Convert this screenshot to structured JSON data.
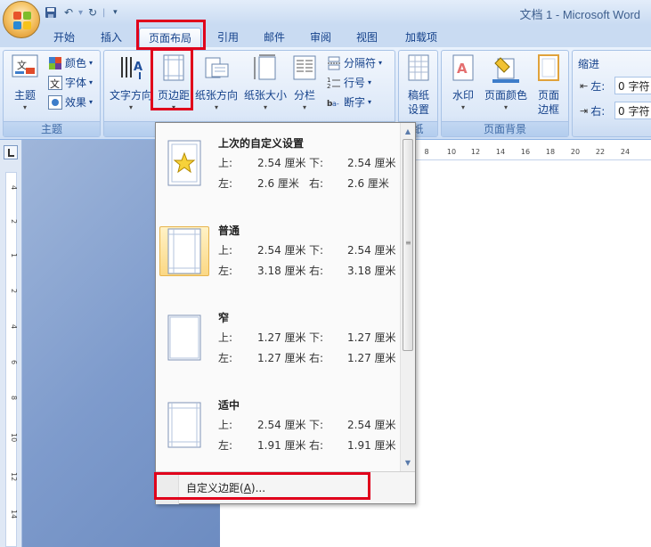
{
  "window": {
    "title": "文档 1 - Microsoft Word"
  },
  "qat": {
    "items": [
      "save-icon",
      "undo-icon",
      "redo-icon",
      "customize-icon"
    ]
  },
  "tabs": [
    {
      "label": "开始"
    },
    {
      "label": "插入"
    },
    {
      "label": "页面布局",
      "active": true
    },
    {
      "label": "引用"
    },
    {
      "label": "邮件"
    },
    {
      "label": "审阅"
    },
    {
      "label": "视图"
    },
    {
      "label": "加载项"
    }
  ],
  "ribbon": {
    "themes": {
      "group_label": "主题",
      "themes_label": "主题",
      "colors_label": "颜色",
      "fonts_label": "字体",
      "effects_label": "效果"
    },
    "page_setup": {
      "text_direction": "文字方向",
      "margins": "页边距",
      "orientation": "纸张方向",
      "size": "纸张大小",
      "columns": "分栏",
      "breaks": "分隔符",
      "line_numbers": "行号",
      "hyphenation": "断字"
    },
    "draft_paper": {
      "label_line1": "稿纸",
      "label_line2": "设置",
      "group_label": "纸"
    },
    "page_background": {
      "group_label": "页面背景",
      "watermark": "水印",
      "page_color": "页面颜色",
      "page_borders_line1": "页面",
      "page_borders_line2": "边框"
    },
    "paragraph": {
      "indent_title": "缩进",
      "left_label": "左:",
      "left_value": "0 字符",
      "right_label": "右:",
      "right_value": "0 字符"
    }
  },
  "rulers": {
    "horizontal_ticks": [
      "8",
      "10",
      "12",
      "14",
      "16",
      "18",
      "20",
      "22",
      "24"
    ],
    "vertical_ticks": [
      "4",
      "2",
      "1",
      "2",
      "4",
      "6",
      "8",
      "10",
      "12",
      "14"
    ]
  },
  "margins_menu": {
    "options": [
      {
        "name": "上次的自定义设置",
        "top_label": "上:",
        "top": "2.54 厘米",
        "bottom_label": "下:",
        "bottom": "2.54 厘米",
        "left_label": "左:",
        "left": "2.6 厘米",
        "right_label": "右:",
        "right": "2.6 厘米",
        "thumb": "star"
      },
      {
        "name": "普通",
        "top_label": "上:",
        "top": "2.54 厘米",
        "bottom_label": "下:",
        "bottom": "2.54 厘米",
        "left_label": "左:",
        "left": "3.18 厘米",
        "right_label": "右:",
        "right": "3.18 厘米",
        "thumb": "normal",
        "selected": true
      },
      {
        "name": "窄",
        "top_label": "上:",
        "top": "1.27 厘米",
        "bottom_label": "下:",
        "bottom": "1.27 厘米",
        "left_label": "左:",
        "left": "1.27 厘米",
        "right_label": "右:",
        "right": "1.27 厘米",
        "thumb": "narrow"
      },
      {
        "name": "适中",
        "top_label": "上:",
        "top": "2.54 厘米",
        "bottom_label": "下:",
        "bottom": "2.54 厘米",
        "left_label": "左:",
        "left": "1.91 厘米",
        "right_label": "右:",
        "right": "1.91 厘米",
        "thumb": "moderate"
      }
    ],
    "footer": {
      "label_main": "自定义边距(",
      "label_accel": "A",
      "label_tail": ")..."
    }
  },
  "colors": {
    "highlight": "#e0001b",
    "ribbon_text": "#15428b",
    "selected_fill": "#fbd884"
  }
}
